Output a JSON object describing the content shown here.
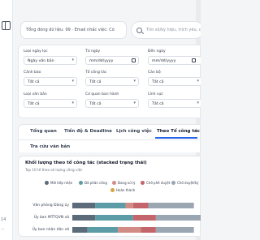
{
  "header": {
    "summary": "Tổng đóng dữ liệu: 99 · Email nhắc việc: Có",
    "search_placeholder": "Tìm số/ký hiệu, trích yếu, cán bộ"
  },
  "rail": {
    "bottom_text_1": "14",
    "bottom_text_2": "..."
  },
  "filters": {
    "loai_ngay_loc": {
      "label": "Loại ngày lọc",
      "value": "Ngày văn bản"
    },
    "tu_ngay": {
      "label": "Từ ngày",
      "value": "mm/dd/yyyy"
    },
    "den_ngay": {
      "label": "Đến ngày",
      "value": "mm/dd/yyyy"
    },
    "canh_bao": {
      "label": "Cảnh báo",
      "value": "Tất cả"
    },
    "to_cong_tac": {
      "label": "Tổ công tác",
      "value": "Tất cả"
    },
    "can_bo": {
      "label": "Cán bộ",
      "value": "Tất cả"
    },
    "loai_van_ban": {
      "label": "Loại văn bản",
      "value": "Tất cả"
    },
    "co_quan_ban_hanh": {
      "label": "Cơ quan ban hành",
      "value": "Tất cả"
    },
    "linh_vuc": {
      "label": "Lĩnh vực",
      "value": "Tất cả"
    }
  },
  "tabs": [
    {
      "label": "Tổng quan"
    },
    {
      "label": "Tiến độ & Deadline"
    },
    {
      "label": "Lịch công việc"
    },
    {
      "label": "Theo Tổ công tác"
    },
    {
      "label": "Tra cứu văn bản"
    }
  ],
  "active_tab": "Theo Tổ công tác",
  "chart": {
    "title": "Khối lượng theo tổ công tác (stacked trạng thái)",
    "subtitle": "Top 10 tổ theo số lượng công việc",
    "legend_labels": [
      "Mới tiếp nhận",
      "Đã phân công",
      "Đang xử lý",
      "Chờ phê duyệt",
      "Chờ duyệt/ký",
      "Hoàn thành"
    ]
  },
  "chart_data": {
    "type": "bar",
    "orientation": "horizontal",
    "stacked": true,
    "title": "Khối lượng theo tổ công tác (stacked trạng thái)",
    "subtitle": "Top 10 tổ theo số lượng công việc",
    "categories": [
      "Văn phòng Đảng ủy",
      "Ủy ban MTTQVN xã",
      "Ủy ban nhân dân xã"
    ],
    "series": [
      {
        "name": "Mới tiếp nhận",
        "color": "#5b6b79",
        "values": [
          3,
          3,
          2
        ]
      },
      {
        "name": "Đã phân công",
        "color": "#5c9ca6",
        "values": [
          4,
          5,
          4
        ]
      },
      {
        "name": "Đang xử lý",
        "color": "#d28c86",
        "values": [
          1,
          0,
          3
        ]
      },
      {
        "name": "Chờ phê duyệt",
        "color": "#c4656b",
        "values": [
          2,
          3,
          2
        ]
      },
      {
        "name": "Chờ duyệt/ký",
        "color": "#9aa6b2",
        "values": [
          6,
          6,
          5
        ]
      },
      {
        "name": "Hoàn thành",
        "color": "#d9a441",
        "values": [
          0,
          0,
          0
        ]
      }
    ],
    "legend_placement": "top"
  }
}
